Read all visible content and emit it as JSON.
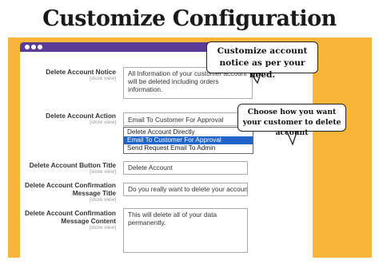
{
  "page_title": "Customize Configuration",
  "callouts": {
    "notice": "Customize account notice as per your need.",
    "action": "Choose how you want your customer to delete account"
  },
  "form": {
    "scope_label": "[store view]",
    "fields": [
      {
        "label": "Delete Account Notice",
        "value": "All Information of your customer account will be deleted including orders information."
      },
      {
        "label": "Delete Account Action",
        "value": "Email To Customer For Approval"
      },
      {
        "label": "Delete Account Button Title",
        "value": "Delete Account"
      },
      {
        "label": "Delete Account Confirmation Message Title",
        "value": "Do you really want to delete your account?"
      },
      {
        "label": "Delete Account Confirmation Message Content",
        "value": "This will delete all of your data permanently."
      }
    ],
    "action_options": [
      "Delete Account Directly",
      "Email To Customer For Approval",
      "Send Request Email To Admin"
    ],
    "selected_option_index": 1
  },
  "colors": {
    "accent_orange": "#f9b43a",
    "window_bar": "#5b3c96",
    "selected_option_bg": "#1f64c8"
  }
}
